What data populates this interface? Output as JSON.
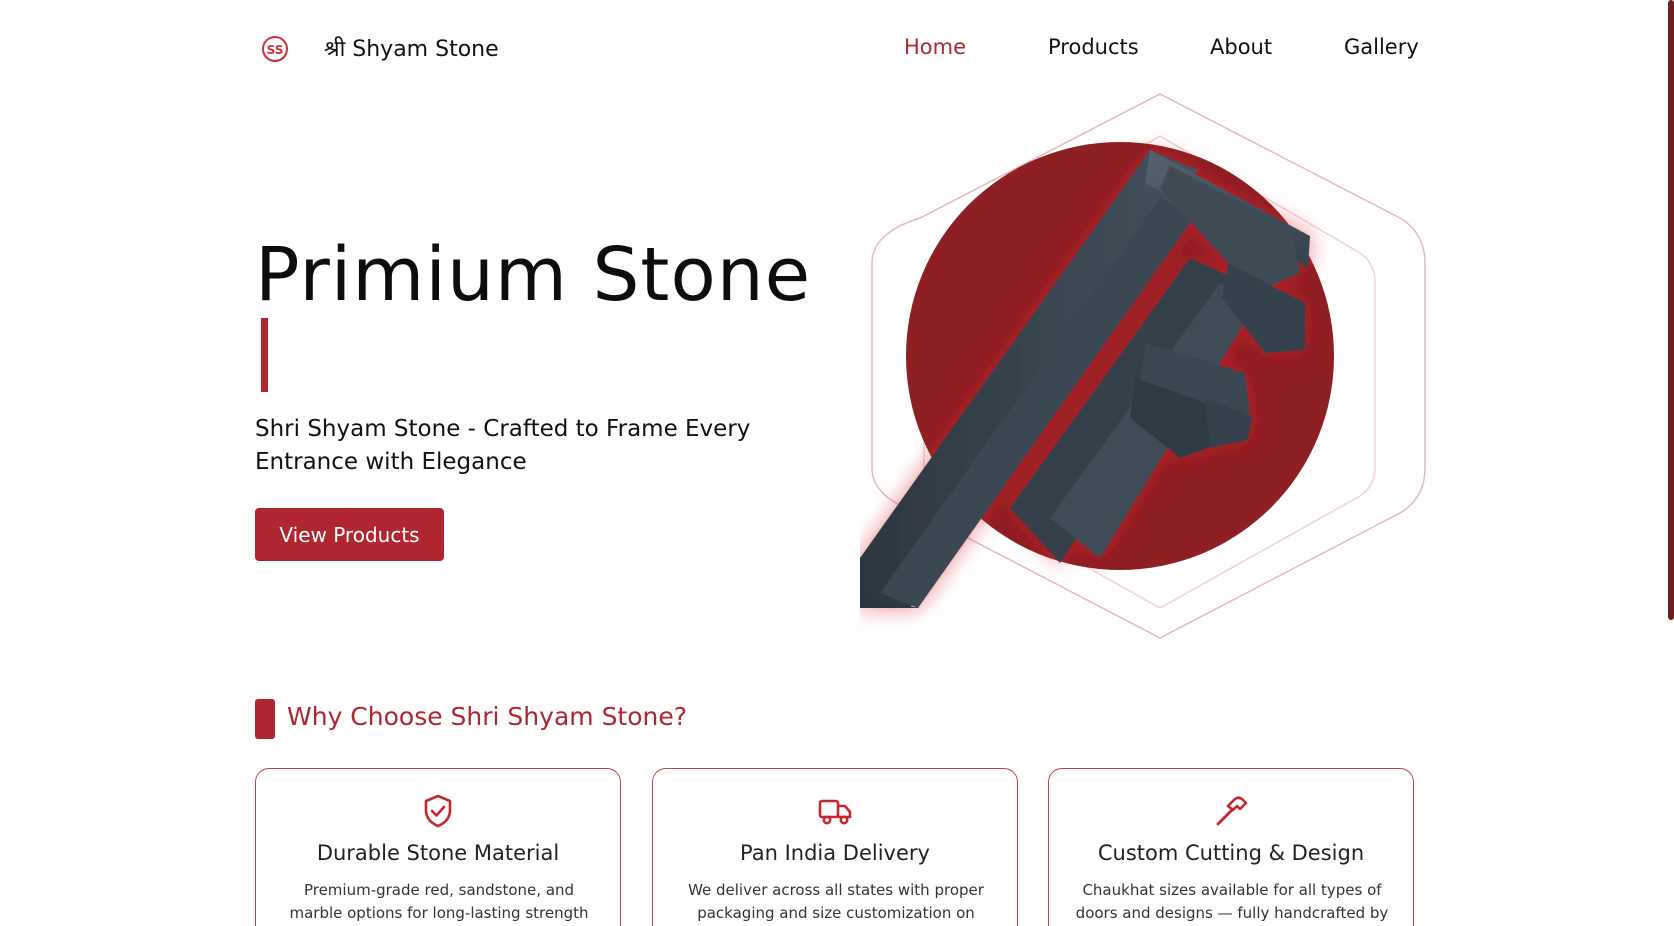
{
  "header": {
    "brand": "श्री Shyam Stone",
    "logo_text": "SS",
    "nav": [
      {
        "label": "Home",
        "active": true
      },
      {
        "label": "Products",
        "active": false
      },
      {
        "label": "About",
        "active": false
      },
      {
        "label": "Gallery",
        "active": false
      }
    ]
  },
  "hero": {
    "title": "Primium Stone",
    "subtitle": "Shri Shyam Stone - Crafted to Frame Every Entrance with Elegance",
    "cta_label": "View Products"
  },
  "why": {
    "title": "Why Choose Shri Shyam Stone?",
    "cards": [
      {
        "icon": "shield-check-icon",
        "title": "Durable Stone Material",
        "text": "Premium-grade red, sandstone, and marble options for long-lasting strength"
      },
      {
        "icon": "truck-icon",
        "title": "Pan India Delivery",
        "text": "We deliver across all states with proper packaging and size customization on"
      },
      {
        "icon": "hammer-icon",
        "title": "Custom Cutting & Design",
        "text": "Chaukhat sizes available for all types of doors and designs — fully handcrafted by"
      }
    ]
  },
  "colors": {
    "accent": "#b0262f",
    "stone": "#3c4a57"
  }
}
